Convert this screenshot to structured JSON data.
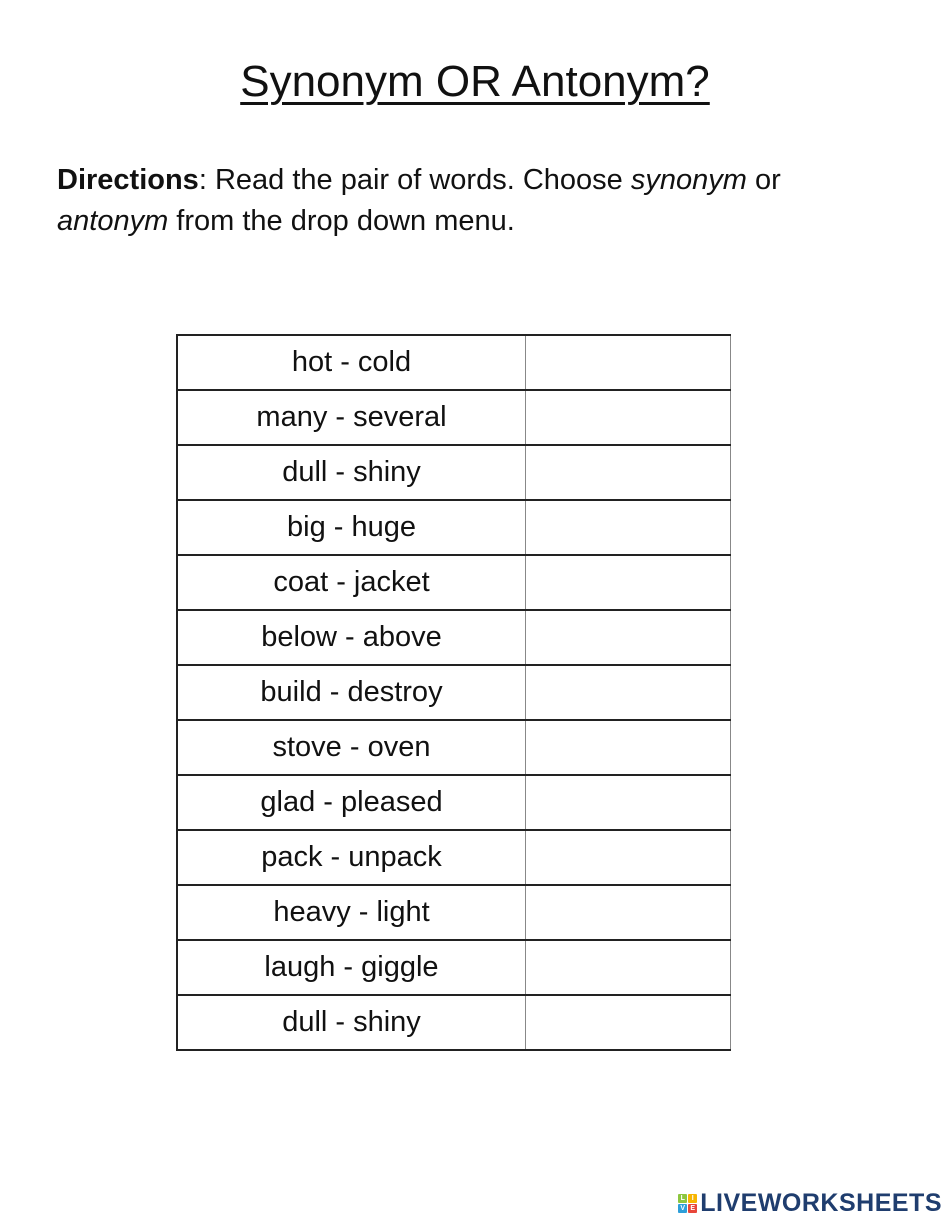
{
  "document": {
    "title": "Synonym OR Antonym?",
    "directions": {
      "label": "Directions",
      "text_part1": ": Read the pair of words. Choose ",
      "option1": "synonym",
      "text_part2": " or ",
      "option2": "antonym",
      "text_part3": " from the drop down menu."
    }
  },
  "table": {
    "rows": [
      {
        "pair": "hot - cold",
        "answer": ""
      },
      {
        "pair": "many - several",
        "answer": ""
      },
      {
        "pair": "dull - shiny",
        "answer": ""
      },
      {
        "pair": "big - huge",
        "answer": ""
      },
      {
        "pair": "coat - jacket",
        "answer": ""
      },
      {
        "pair": "below - above",
        "answer": ""
      },
      {
        "pair": "build - destroy",
        "answer": ""
      },
      {
        "pair": "stove - oven",
        "answer": ""
      },
      {
        "pair": "glad - pleased",
        "answer": ""
      },
      {
        "pair": "pack - unpack",
        "answer": ""
      },
      {
        "pair": "heavy - light",
        "answer": ""
      },
      {
        "pair": "laugh - giggle",
        "answer": ""
      },
      {
        "pair": "dull - shiny",
        "answer": ""
      }
    ]
  },
  "footer": {
    "logo": {
      "text": "LIVEWORKSHEETS",
      "icon_letters": [
        "L",
        "I",
        "V",
        "E"
      ],
      "icon_colors": [
        "#8dc63f",
        "#f7b500",
        "#2e9fd9",
        "#e8463a"
      ],
      "text_color": "#1f3d6e"
    }
  }
}
